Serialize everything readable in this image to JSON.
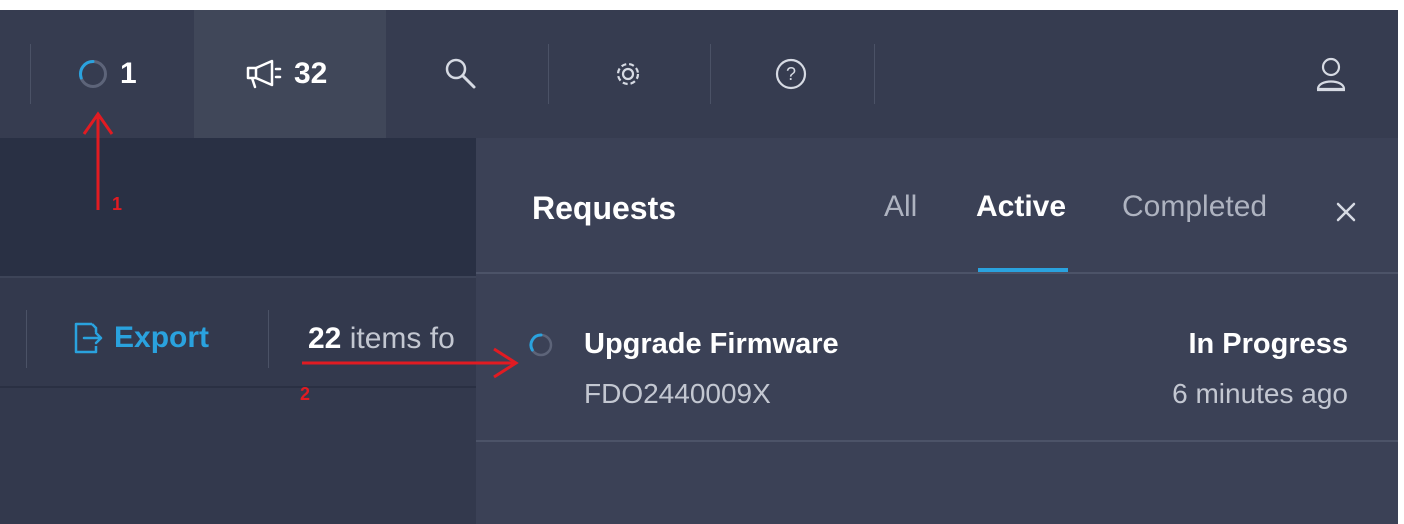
{
  "topbar": {
    "active_requests_count": "1",
    "notifications_count": "32",
    "icons": [
      "spinner-icon",
      "megaphone-icon",
      "search-icon",
      "gear-icon",
      "help-icon",
      "user-icon"
    ]
  },
  "toolbar": {
    "export_label": "Export",
    "items_count": "22",
    "items_text": "items fo"
  },
  "requests_panel": {
    "title": "Requests",
    "tabs": [
      {
        "label": "All",
        "active": false
      },
      {
        "label": "Active",
        "active": true
      },
      {
        "label": "Completed",
        "active": false
      }
    ],
    "close_icon": "close-icon",
    "requests": [
      {
        "name": "Upgrade Firmware",
        "target": "FDO2440009X",
        "status": "In Progress",
        "time": "6 minutes ago"
      }
    ]
  },
  "annotations": [
    {
      "label": "1"
    },
    {
      "label": "2"
    }
  ],
  "colors": {
    "accent": "#2aa2de",
    "annotation": "#e11b22",
    "topbar_bg": "#363c50",
    "panel_bg": "#3b4156"
  }
}
